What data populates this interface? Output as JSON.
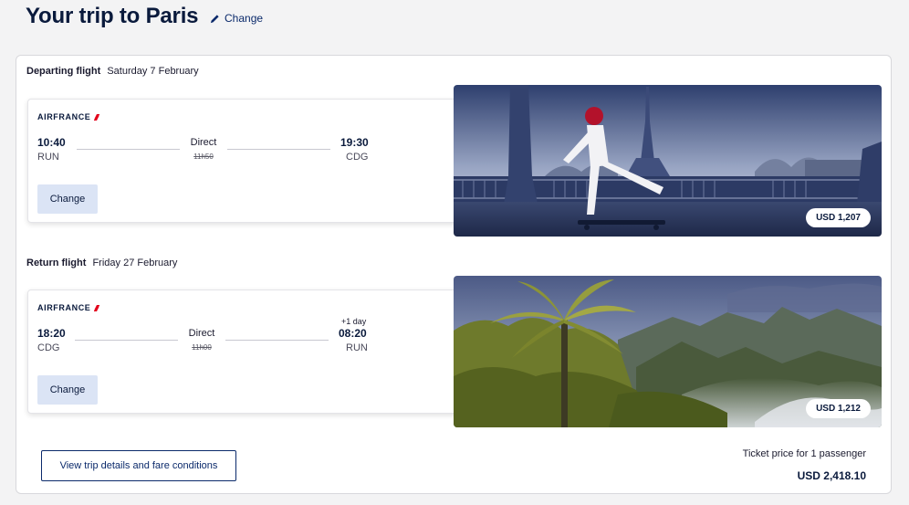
{
  "header": {
    "title": "Your trip to Paris",
    "change_label": "Change"
  },
  "outbound": {
    "label": "Departing flight",
    "date": "Saturday 7 February",
    "airline": "AIRFRANCE",
    "dep_time": "10:40",
    "dep_code": "RUN",
    "arr_time": "19:30",
    "arr_code": "CDG",
    "stops": "Direct",
    "duration": "11h50",
    "change_label": "Change",
    "price": "USD 1,207"
  },
  "return": {
    "label": "Return flight",
    "date": "Friday 27 February",
    "airline": "AIRFRANCE",
    "dep_time": "18:20",
    "dep_code": "CDG",
    "arr_time": "08:20",
    "arr_code": "RUN",
    "day_offset": "+1 day",
    "stops": "Direct",
    "duration": "11h00",
    "change_label": "Change",
    "price": "USD 1,212"
  },
  "footer": {
    "details_label": "View trip details and fare conditions",
    "ticket_label": "Ticket price for 1 passenger",
    "total": "USD 2,418.10"
  },
  "colors": {
    "brand_navy": "#0a1a3c",
    "link_blue": "#0b2a6b",
    "button_bg": "#dbe4f5",
    "airline_red": "#e3001b"
  }
}
